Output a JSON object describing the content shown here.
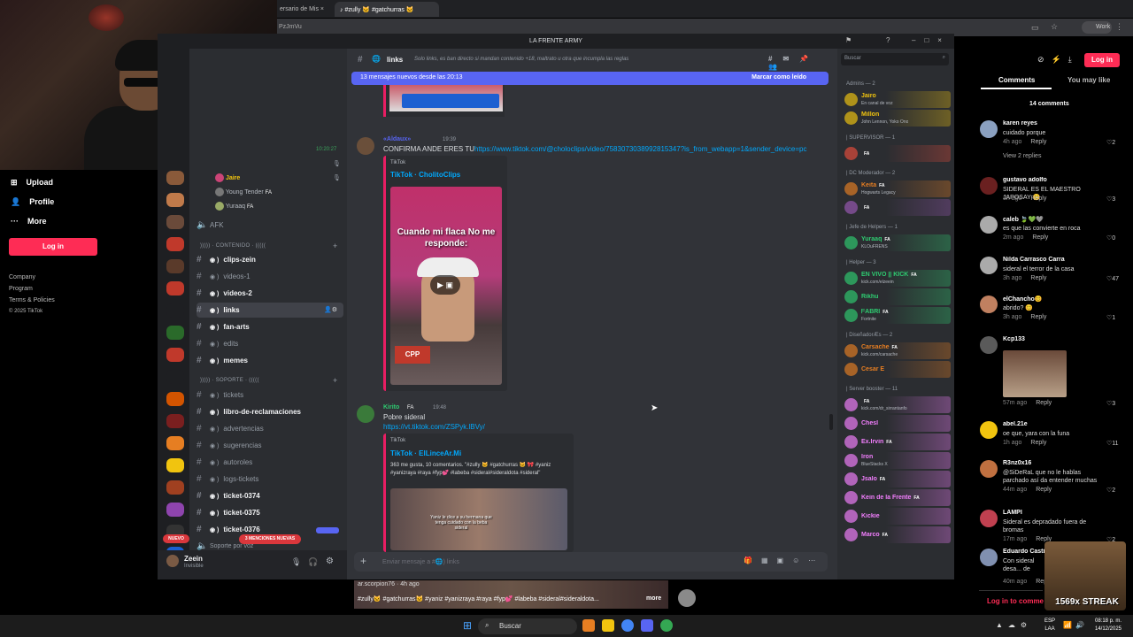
{
  "browser": {
    "tab1": "ersario de Mis",
    "tab2": "#zully 🐱 #gatchurras 🐱",
    "url": "PzJmVu",
    "profile": "Work"
  },
  "tiktok_left": {
    "nav": [
      "Upload",
      "Profile",
      "More"
    ],
    "login": "Log in",
    "footer": [
      "Company",
      "Program",
      "Terms & Policies",
      "© 2025 TikTok"
    ]
  },
  "discord": {
    "window_title": "LA FRENTE ARMY",
    "voice_users": [
      {
        "time": "10:20:27",
        "name": "Jaire"
      },
      {
        "name": "Young Tender",
        "tag": "FA"
      },
      {
        "name": "Yuraaq",
        "tag": "FA"
      }
    ],
    "afk": "AFK",
    "cat_contenido": "))))) · CONTENIDO · ((((( ",
    "channels_contenido": [
      {
        "name": "clips-zein",
        "bold": true
      },
      {
        "name": "videos-1",
        "bold": false
      },
      {
        "name": "videos-2",
        "bold": true
      },
      {
        "name": "links",
        "bold": true,
        "selected": true
      },
      {
        "name": "fan-arts",
        "bold": true
      },
      {
        "name": "edits",
        "bold": false
      },
      {
        "name": "memes",
        "bold": true
      }
    ],
    "cat_soporte": "))))) · SOPORTE · (((((",
    "channels_soporte": [
      {
        "name": "tickets",
        "bold": false
      },
      {
        "name": "libro-de-reclamaciones",
        "bold": true
      },
      {
        "name": "advertencias",
        "bold": false
      },
      {
        "name": "sugerencias",
        "bold": false
      },
      {
        "name": "autoroles",
        "bold": false
      },
      {
        "name": "logs-tickets",
        "bold": false
      },
      {
        "name": "ticket-0374",
        "bold": true
      },
      {
        "name": "ticket-0375",
        "bold": true
      },
      {
        "name": "ticket-0376",
        "bold": true
      }
    ],
    "soporte_voz": "Soporte por voz",
    "mentions_badge": "3 MENCIONES NUEVAS",
    "nuevo_badge": "NUEVO",
    "user": {
      "name": "Zeein",
      "status": "Invisible"
    },
    "channel_header": {
      "name": "links",
      "topic": "Solo links, es ban directo si mandan contenido +18, maltrato u otra que incumpla las reglas"
    },
    "new_messages_bar": {
      "text": "13 mensajes nuevos desde las 20:13",
      "action": "Marcar como leído"
    },
    "messages": [
      {
        "author": "«Aldaux»",
        "time": "19:39",
        "text": "CONFIRMA ANDE ERES TU",
        "link": "https://www.tiktok.com/@choloclips/video/7583073038992815347?is_from_webapp=1&sender_device=pc",
        "embed_provider": "TikTok",
        "embed_title": "TikTok · CholitoClips",
        "video_caption": "Cuando mi flaca No me responde:"
      },
      {
        "author": "Kirito",
        "tag": "FA",
        "time": "19:48",
        "text": "Pobre sideral",
        "link": "https://vt.tiktok.com/ZSPyk.lBVy/",
        "embed_provider": "TikTok",
        "embed_title": "TikTok · ElLinceAr.Mi",
        "embed_desc": "363 me gusta, 10 comentarios. \"#zully 🐱 #gatchurras 🐱 🎀 #yaniz #yanizraya #raya #fyp💕 #labeba #sideral#sideraldota #sideral\"",
        "video_caption": "Yaniz le dice a su hermana que tenga cuidado con la beba sideral"
      }
    ],
    "composer_placeholder": "Enviar mensaje a #🌐) links",
    "search_placeholder": "Buscar",
    "member_groups": [
      {
        "title": "Admins — 2",
        "members": [
          {
            "name": "Jairo",
            "sub": "En canal de voz",
            "color": "#f1c40f"
          },
          {
            "name": "Millon",
            "sub": "John Lennon, Yoko Ono",
            "color": "#f1c40f"
          }
        ]
      },
      {
        "title": "| SUPERVISOR — 1",
        "members": [
          {
            "name": "",
            "tag": "FA",
            "color": "#e74c3c"
          }
        ]
      },
      {
        "title": "| DC Moderador — 2",
        "members": [
          {
            "name": "Keita",
            "tag": "FA",
            "sub": "Hogwarts Legacy",
            "color": "#e67e22"
          },
          {
            "name": "",
            "tag": "FA",
            "color": "#9b59b6"
          }
        ]
      },
      {
        "title": "| Jefe de Helpers — 1",
        "members": [
          {
            "name": "Yuraaq",
            "tag": "FA",
            "sub": "KLOuFRENS",
            "color": "#2ecc71"
          }
        ]
      },
      {
        "title": "| Helper — 3",
        "members": [
          {
            "name": "EN VIVO || KICK",
            "tag": "FA",
            "sub": "kick.com/elzeein",
            "color": "#2ecc71"
          },
          {
            "name": "Rikhu",
            "color": "#2ecc71"
          },
          {
            "name": "ᖴABRI",
            "tag": "FA",
            "sub": "Fortnite",
            "color": "#2ecc71"
          }
        ]
      },
      {
        "title": "| DiseñadorÆs — 2",
        "members": [
          {
            "name": "Carsache",
            "tag": "FA",
            "sub": "kick.com/carsache",
            "color": "#e67e22"
          },
          {
            "name": "Cesar E",
            "color": "#e67e22"
          }
        ]
      },
      {
        "title": "| Server booster — 11",
        "members": [
          {
            "name": "",
            "tag": "FA",
            "sub": "kick.com/dr_sirrantanfo",
            "color": "#f47fff"
          },
          {
            "name": "Chesl",
            "color": "#f47fff"
          },
          {
            "name": "Ex.Irvin",
            "tag": "FA",
            "color": "#f47fff"
          },
          {
            "name": "Iron",
            "sub": "BlueStacks X",
            "color": "#f47fff"
          },
          {
            "name": "Jsalo",
            "tag": "FA",
            "color": "#f47fff"
          },
          {
            "name": "Kein de la Frente",
            "tag": "FA",
            "color": "#f47fff"
          },
          {
            "name": "Kickie",
            "color": "#f47fff"
          },
          {
            "name": "Marco",
            "tag": "FA",
            "color": "#f47fff"
          }
        ]
      }
    ]
  },
  "tiktok_right": {
    "login": "Log in",
    "tabs": [
      "Comments",
      "You may like"
    ],
    "count": "14 comments",
    "comments": [
      {
        "name": "karen reyes",
        "text": "cuidado porque",
        "time": "4h ago",
        "likes": "2",
        "replies": "View 2 replies"
      },
      {
        "name": "gustavo adolfo",
        "text": "SIDERAL ES EL MAESTRO JAPOSAY 😊",
        "time": "3h ago",
        "likes": "3"
      },
      {
        "name": "caleb 🍃💚🩶",
        "text": "es que las convierte en roca",
        "time": "2m ago",
        "likes": "0"
      },
      {
        "name": "Nilda Carrasco Carra",
        "text": "sideral el terror de la casa",
        "time": "3h ago",
        "likes": "47"
      },
      {
        "name": "elChancho😊",
        "text": "abrido? 😊",
        "time": "3h ago",
        "likes": "1"
      },
      {
        "name": "Kcp133",
        "text": "",
        "time": "57m ago",
        "likes": "3"
      },
      {
        "name": "abel.21e",
        "text": "oe que, yara con la funa",
        "time": "1h ago",
        "likes": "11"
      },
      {
        "name": "R3nz0x16",
        "text": "@SiDeRaL que no le hablas parchado así da entender muchas cosas ah",
        "time": "44m ago",
        "likes": "2"
      },
      {
        "name": "LAMPI",
        "text": "Sideral es depradado fuera de bromas",
        "time": "17m ago",
        "likes": "2"
      },
      {
        "name": "Eduardo Castillo",
        "text": "Con sideral desa... de todas las chi...",
        "time": "40m ago",
        "likes": ""
      }
    ],
    "login_comment": "Log in to comment",
    "streak": "1569x STREAK"
  },
  "bottom_video": {
    "user": "ar.scorpion76 · 4h ago",
    "caption": "#zully🐱 #gatchurras🐱 #yaniz #yanizraya #raya #fyp💕 #labeba #sideral#sideraldota...",
    "more": "more"
  },
  "taskbar": {
    "search": "Buscar",
    "lang": [
      "ESP",
      "LAA"
    ],
    "time": "08:18 p. m.",
    "date": "14/12/2025"
  }
}
